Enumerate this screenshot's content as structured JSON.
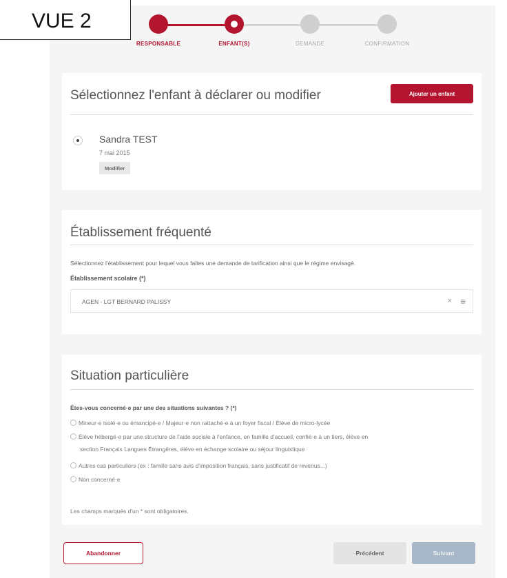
{
  "view_label": "VUE 2",
  "stepper": {
    "steps": [
      {
        "label": "RESPONSABLE",
        "state": "done"
      },
      {
        "label": "ENFANT(S)",
        "state": "current"
      },
      {
        "label": "DEMANDE",
        "state": "todo"
      },
      {
        "label": "CONFIRMATION",
        "state": "todo"
      }
    ]
  },
  "child_section": {
    "title": "Sélectionnez l'enfant à déclarer ou modifier",
    "add_button": "Ajouter un enfant",
    "child": {
      "name": "Sandra TEST",
      "birthdate": "7 mai 2015",
      "modify_button": "Modifier",
      "selected": true
    }
  },
  "school_section": {
    "title": "Établissement fréquenté",
    "description": "Sélectionnez l'établissement pour lequel vous faites une demande de tarification ainsi que le régime envisagé.",
    "field_label": "Établissement scolaire (*)",
    "selected_value": "AGEN - LGT BERNARD PALISSY",
    "clear_symbol": "×"
  },
  "situation_section": {
    "title": "Situation particulière",
    "question": "Êtes-vous concerné·e par une des situations suivantes ? (*)",
    "options": [
      {
        "line1": "Mineur·e isolé·e ou émancipé·e / Majeur·e non rattaché·e à un foyer fiscal / Élève de micro-lycée",
        "line2": ""
      },
      {
        "line1": "Élève hébergé·e par une structure de l'aide sociale à l'enfance, en famille d'accueil, confié·e à un tiers, élève en",
        "line2": "section Français Langues Étrangères, élève en échange scolaire ou séjour linguistique"
      },
      {
        "line1": "Autres cas particuliers (ex : famille sans avis d'imposition français, sans justificatif de revenus...)",
        "line2": ""
      },
      {
        "line1": "Non concerné·e",
        "line2": ""
      }
    ],
    "mandatory_note": "Les champs marqués d'un * sont obligatoires."
  },
  "footer": {
    "abandon_button": "Abandonner",
    "previous_button": "Précédent",
    "next_button": "Suivant"
  },
  "colors": {
    "accent": "#b3142e",
    "disabled_button": "#a8b8c8",
    "background": "#f5f5f5"
  }
}
